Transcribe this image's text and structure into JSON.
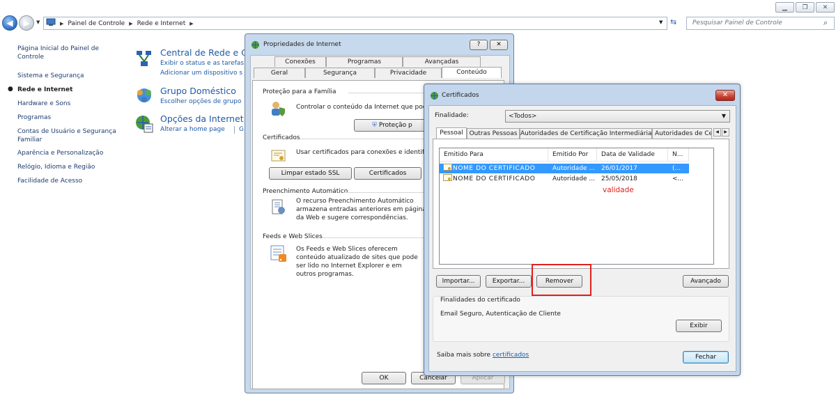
{
  "explorer": {
    "breadcrumb": [
      "Painel de Controle",
      "Rede e Internet"
    ],
    "search_placeholder": "Pesquisar Painel de Controle"
  },
  "leftnav": {
    "items": [
      {
        "label": "Página Inicial do Painel de Controle",
        "active": false
      },
      {
        "label": "Sistema e Segurança",
        "active": false
      },
      {
        "label": "Rede e Internet",
        "active": true
      },
      {
        "label": "Hardware e Sons",
        "active": false
      },
      {
        "label": "Programas",
        "active": false
      },
      {
        "label": "Contas de Usuário e Segurança Familiar",
        "active": false
      },
      {
        "label": "Aparência e Personalização",
        "active": false
      },
      {
        "label": "Relógio, Idioma e Região",
        "active": false
      },
      {
        "label": "Facilidade de Acesso",
        "active": false
      }
    ]
  },
  "categories": [
    {
      "title": "Central de Rede e Co",
      "links": [
        "Exibir o status e as tarefas d",
        "Adicionar um dispositivo s"
      ]
    },
    {
      "title": "Grupo Doméstico",
      "links": [
        "Escolher opções de grupo"
      ]
    },
    {
      "title": "Opções da Internet",
      "links": [
        "Alterar a home page",
        "G"
      ]
    }
  ],
  "internet_properties": {
    "title": "Propriedades de Internet",
    "tabs_top": [
      "Conexões",
      "Programas",
      "Avançadas"
    ],
    "tabs_bottom": [
      "Geral",
      "Segurança",
      "Privacidade",
      "Conteúdo"
    ],
    "family": {
      "heading": "Proteção para a Família",
      "text": "Controlar o conteúdo da Internet que pode",
      "button": "Proteção p"
    },
    "certificates": {
      "heading": "Certificados",
      "text": "Usar certificados para conexões e identifica",
      "btn_ssl": "Limpar estado SSL",
      "btn_cert": "Certificados"
    },
    "autocomplete": {
      "heading": "Preenchimento Automático",
      "lines": [
        "O recurso Preenchimento Automático",
        "armazena entradas anteriores em páginas",
        "da Web e sugere correspondências."
      ]
    },
    "feeds": {
      "heading": "Feeds e Web Slices",
      "lines": [
        "Os Feeds e Web Slices oferecem",
        "conteúdo atualizado de sites que pode",
        "ser lido no Internet Explorer e em",
        "outros programas."
      ]
    },
    "ok": "OK",
    "cancel": "Cancelar",
    "apply": "Aplicar"
  },
  "certificates_dialog": {
    "title": "Certificados",
    "purpose_label": "Finalidade:",
    "purpose_value": "<Todos>",
    "tabs": [
      "Pessoal",
      "Outras Pessoas",
      "Autoridades de Certificação Intermediárias",
      "Autoridades de Ce"
    ],
    "columns": [
      "Emitido Para",
      "Emitido Por",
      "Data de Validade",
      "N..."
    ],
    "rows": [
      {
        "issued_to": "NOME DO CERTIFICADO",
        "issued_by": "Autoridade ...",
        "expiry": "26/01/2017",
        "name": "(..."
      },
      {
        "issued_to": "NOME DO CERTIFICADO",
        "issued_by": "Autoridade ...",
        "expiry": "25/05/2018",
        "name": "<..."
      }
    ],
    "annotation": "validade",
    "btn_import": "Importar...",
    "btn_export": "Exportar...",
    "btn_remove": "Remover",
    "btn_advanced": "Avançado",
    "purposes_heading": "Finalidades do certificado",
    "purposes_text": "Email Seguro, Autenticação de Cliente",
    "btn_view": "Exibir",
    "learn_more": "Saiba mais sobre",
    "learn_more_link": "certificados",
    "btn_close": "Fechar"
  },
  "colors": {
    "accent_link": "#1e5aa6",
    "highlight": "#3399ff",
    "annotation_red": "#e0201c"
  }
}
